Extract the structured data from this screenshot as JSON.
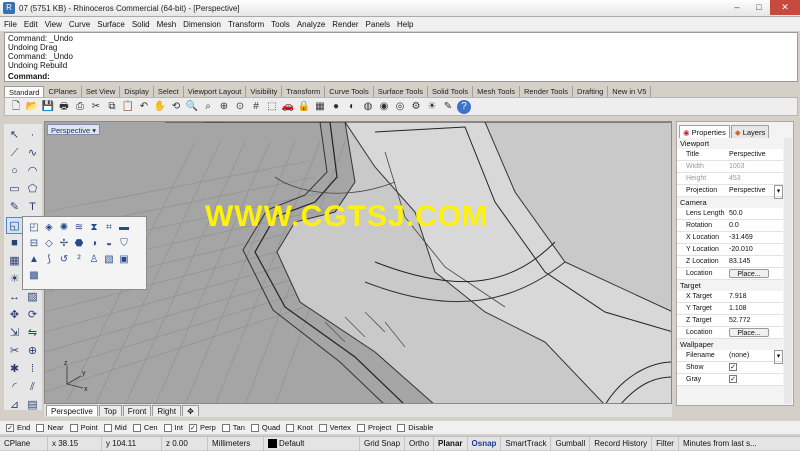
{
  "window": {
    "title": "07 (5751 KB) - Rhinoceros Commercial (64-bit) - [Perspective]",
    "controls": {
      "minimize": "–",
      "maximize": "□",
      "close": "✕"
    }
  },
  "menu": [
    "File",
    "Edit",
    "View",
    "Curve",
    "Surface",
    "Solid",
    "Mesh",
    "Dimension",
    "Transform",
    "Tools",
    "Analyze",
    "Render",
    "Panels",
    "Help"
  ],
  "command_history": [
    "Command: _Undo",
    "Undoing Drag",
    "Command: _Undo",
    "Undoing Rebuild"
  ],
  "command_prompt": "Command:",
  "toolbar_tabs": [
    "Standard",
    "CPlanes",
    "Set View",
    "Display",
    "Select",
    "Viewport Layout",
    "Visibility",
    "Transform",
    "Curve Tools",
    "Surface Tools",
    "Solid Tools",
    "Mesh Tools",
    "Render Tools",
    "Drafting",
    "New in V5"
  ],
  "standard_toolbar_icons": [
    "new-icon",
    "open-icon",
    "save-icon",
    "print-icon",
    "import-icon",
    "cut-icon",
    "copy-icon",
    "paste-icon",
    "undo-icon",
    "pan-icon",
    "rotate-view-icon",
    "zoom-icon",
    "zoom-window-icon",
    "zoom-extents-icon",
    "zoom-selected-icon",
    "grid-icon",
    "select-icon",
    "car-icon",
    "lock-icon",
    "layer-icon",
    "shade-icon",
    "rendered-icon",
    "material-icon",
    "sphere-icon",
    "render-icon",
    "options-icon",
    "light-icon",
    "settings-icon",
    "help-icon"
  ],
  "standard_toolbar_glyphs": [
    "🗋",
    "📂",
    "💾",
    "🖶",
    "⎙",
    "✂",
    "⧉",
    "📋",
    "↶",
    "✋",
    "⟲",
    "🔍",
    "⌕",
    "⊕",
    "⊙",
    "#",
    "⬚",
    "🚗",
    "🔒",
    "▦",
    "●",
    "◐",
    "◍",
    "◉",
    "◎",
    "⚙",
    "☀",
    "✎",
    "?"
  ],
  "viewport": {
    "label": "Perspective",
    "dropdown": "▾",
    "watermark": "WWW.CGTSJ.COM",
    "axis_z": "z",
    "axis_y": "y",
    "axis_x": "x"
  },
  "view_tabs": [
    "Perspective",
    "Top",
    "Front",
    "Right"
  ],
  "view_tab_add": "✥",
  "properties_panel": {
    "tabs": [
      "Properties",
      "Layers"
    ],
    "sections": {
      "viewport": {
        "header": "Viewport",
        "title_label": "Title",
        "title_value": "Perspective",
        "width_label": "Width",
        "width_value": "1003",
        "height_label": "Height",
        "height_value": "453",
        "projection_label": "Projection",
        "projection_value": "Perspective"
      },
      "camera": {
        "header": "Camera",
        "lens_label": "Lens Length",
        "lens_value": "50.0",
        "rotation_label": "Rotation",
        "rotation_value": "0.0",
        "x_label": "X Location",
        "x_value": "-31.469",
        "y_label": "Y Location",
        "y_value": "-20.010",
        "z_label": "Z Location",
        "z_value": "83.145",
        "location_label": "Location",
        "location_button": "Place..."
      },
      "target": {
        "header": "Target",
        "x_label": "X Target",
        "x_value": "7.918",
        "y_label": "Y Target",
        "y_value": "1.108",
        "z_label": "Z Target",
        "z_value": "52.772",
        "location_label": "Location",
        "location_button": "Place..."
      },
      "wallpaper": {
        "header": "Wallpaper",
        "filename_label": "Filename",
        "filename_value": "(none)",
        "show_label": "Show",
        "show_checked": true,
        "gray_label": "Gray",
        "gray_checked": true
      }
    }
  },
  "osnaps": [
    {
      "label": "End",
      "checked": true
    },
    {
      "label": "Near",
      "checked": false
    },
    {
      "label": "Point",
      "checked": false
    },
    {
      "label": "Mid",
      "checked": false
    },
    {
      "label": "Cen",
      "checked": false
    },
    {
      "label": "Int",
      "checked": false
    },
    {
      "label": "Perp",
      "checked": true
    },
    {
      "label": "Tan",
      "checked": false
    },
    {
      "label": "Quad",
      "checked": false
    },
    {
      "label": "Knot",
      "checked": false
    },
    {
      "label": "Vertex",
      "checked": false
    },
    {
      "label": "Project",
      "checked": false
    },
    {
      "label": "Disable",
      "checked": false
    }
  ],
  "status_bar": {
    "cplane": "CPlane",
    "x": "x 38.15",
    "y": "y 104.11",
    "z": "z 0.00",
    "units": "Millimeters",
    "layer": "Default",
    "grid_snap": "Grid Snap",
    "ortho": "Ortho",
    "planar": "Planar",
    "osnap": "Osnap",
    "smarttrack": "SmartTrack",
    "gumball": "Gumball",
    "record_history": "Record History",
    "filter": "Filter",
    "message": "Minutes from last s..."
  },
  "colors": {
    "osnap_active": "#1a3b8f",
    "watermark": "#fff20a",
    "layer_swatch": "#000000"
  }
}
